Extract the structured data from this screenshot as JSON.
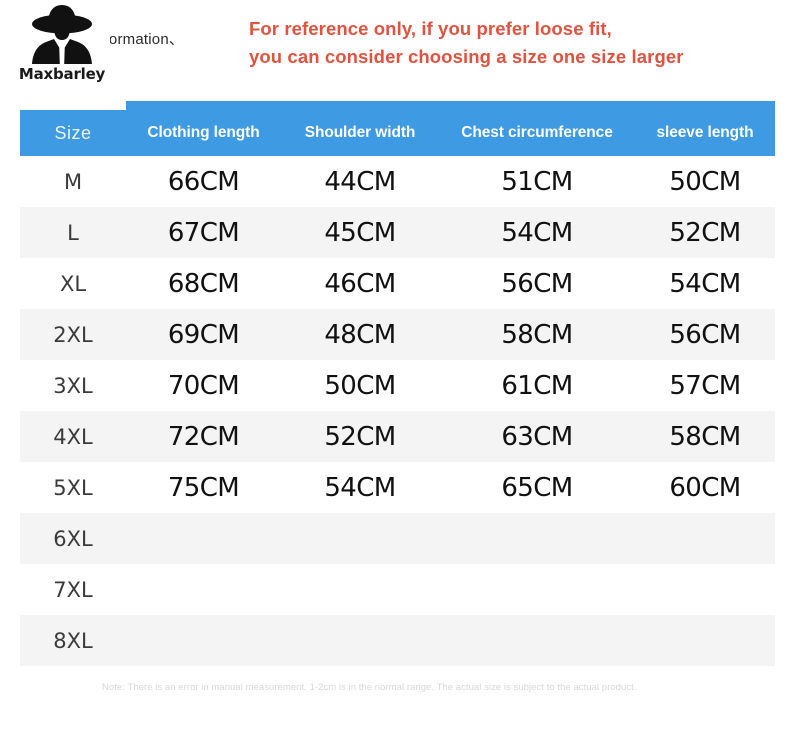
{
  "brand": {
    "name": "Maxbarley",
    "logo_icon": "person-in-hat-silhouette-icon"
  },
  "header": {
    "section_caption": "nformation、",
    "notice_line_1": "For reference only, if you prefer loose fit,",
    "notice_line_2": "you can consider choosing a size one size larger",
    "notice_color": "#e0533f",
    "header_band_color": "#3d9ae3"
  },
  "table": {
    "columns": [
      "Size",
      "Clothing length",
      "Shoulder width",
      "Chest circumference",
      "sleeve length"
    ],
    "rows": [
      {
        "size": "M",
        "clothing_length": "66CM",
        "shoulder_width": "44CM",
        "chest_circumference": "51CM",
        "sleeve_length": "50CM"
      },
      {
        "size": "L",
        "clothing_length": "67CM",
        "shoulder_width": "45CM",
        "chest_circumference": "54CM",
        "sleeve_length": "52CM"
      },
      {
        "size": "XL",
        "clothing_length": "68CM",
        "shoulder_width": "46CM",
        "chest_circumference": "56CM",
        "sleeve_length": "54CM"
      },
      {
        "size": "2XL",
        "clothing_length": "69CM",
        "shoulder_width": "48CM",
        "chest_circumference": "58CM",
        "sleeve_length": "56CM"
      },
      {
        "size": "3XL",
        "clothing_length": "70CM",
        "shoulder_width": "50CM",
        "chest_circumference": "61CM",
        "sleeve_length": "57CM"
      },
      {
        "size": "4XL",
        "clothing_length": "72CM",
        "shoulder_width": "52CM",
        "chest_circumference": "63CM",
        "sleeve_length": "58CM"
      },
      {
        "size": "5XL",
        "clothing_length": "75CM",
        "shoulder_width": "54CM",
        "chest_circumference": "65CM",
        "sleeve_length": "60CM"
      },
      {
        "size": "6XL",
        "clothing_length": "",
        "shoulder_width": "",
        "chest_circumference": "",
        "sleeve_length": ""
      },
      {
        "size": "7XL",
        "clothing_length": "",
        "shoulder_width": "",
        "chest_circumference": "",
        "sleeve_length": ""
      },
      {
        "size": "8XL",
        "clothing_length": "",
        "shoulder_width": "",
        "chest_circumference": "",
        "sleeve_length": ""
      }
    ],
    "stripe_color": "#f4f4f4"
  },
  "footer": {
    "note": "Note: There is an error in manual measurement. 1-2cm is in the normal range. The actual size is subject to the actual product."
  }
}
